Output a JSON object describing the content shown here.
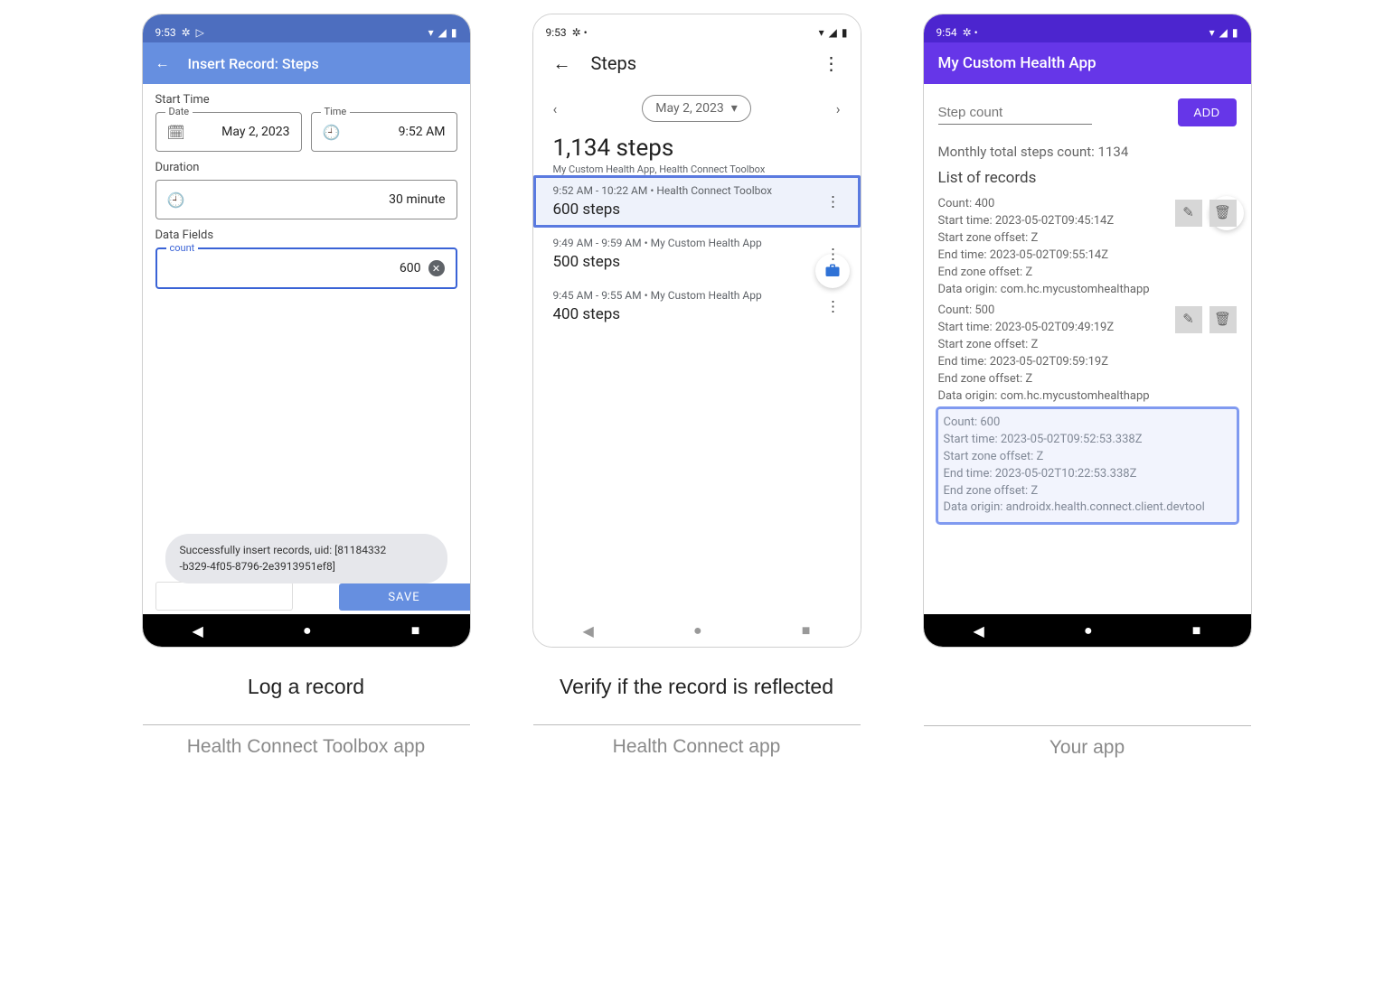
{
  "captions": {
    "left": "Log a record",
    "right": "Verify if the record is reflected",
    "p1_sub": "Health Connect Toolbox app",
    "p2_sub": "Health Connect app",
    "p3_sub": "Your app"
  },
  "phone1": {
    "status_time": "9:53",
    "title": "Insert Record: Steps",
    "start_label": "Start Time",
    "date_legend": "Date",
    "date_value": "May 2, 2023",
    "time_legend": "Time",
    "time_value": "9:52 AM",
    "duration_label": "Duration",
    "duration_value": "30 minute",
    "data_fields_label": "Data Fields",
    "count_legend": "count",
    "count_value": "600",
    "toast": "Successfully insert records, uid: [81184332\n-b329-4f05-8796-2e3913951ef8]",
    "save": "SAVE"
  },
  "phone2": {
    "status_time": "9:53",
    "title": "Steps",
    "date": "May 2, 2023",
    "total": "1,134 steps",
    "total_sub": "My Custom Health App, Health Connect Toolbox",
    "entries": [
      {
        "meta": "9:52 AM - 10:22 AM • Health Connect Toolbox",
        "big": "600 steps",
        "hl": true
      },
      {
        "meta": "9:49 AM - 9:59 AM • My Custom Health App",
        "big": "500 steps",
        "hl": false
      },
      {
        "meta": "9:45 AM - 9:55 AM • My Custom Health App",
        "big": "400 steps",
        "hl": false
      }
    ]
  },
  "phone3": {
    "status_time": "9:54",
    "title": "My Custom Health App",
    "input_placeholder": "Step count",
    "add": "ADD",
    "monthly": "Monthly total steps count: 1134",
    "list_head": "List of records",
    "records": [
      {
        "hl": false,
        "lines": [
          "Count: 400",
          "Start time: 2023-05-02T09:45:14Z",
          "Start zone offset: Z",
          "End time: 2023-05-02T09:55:14Z",
          "End zone offset: Z",
          "Data origin: com.hc.mycustomhealthapp"
        ]
      },
      {
        "hl": false,
        "lines": [
          "Count: 500",
          "Start time: 2023-05-02T09:49:19Z",
          "Start zone offset: Z",
          "End time: 2023-05-02T09:59:19Z",
          "End zone offset: Z",
          "Data origin: com.hc.mycustomhealthapp"
        ]
      },
      {
        "hl": true,
        "lines": [
          "Count: 600",
          "Start time: 2023-05-02T09:52:53.338Z",
          "Start zone offset: Z",
          "End time: 2023-05-02T10:22:53.338Z",
          "End zone offset: Z",
          "Data origin: androidx.health.connect.client.devtool"
        ]
      }
    ]
  }
}
